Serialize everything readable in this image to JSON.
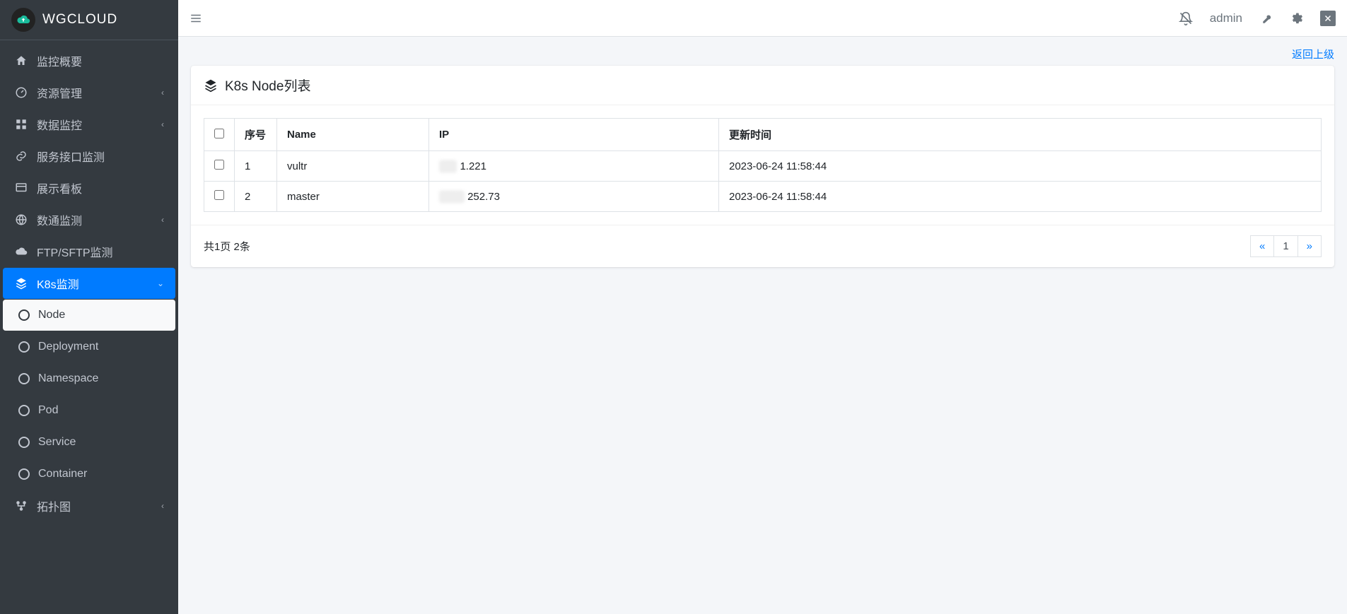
{
  "brand": {
    "text": "WGCLOUD"
  },
  "sidebar": {
    "items": [
      {
        "label": "监控概要",
        "icon": "home"
      },
      {
        "label": "资源管理",
        "icon": "dashboard",
        "chevron": true
      },
      {
        "label": "数据监控",
        "icon": "grid",
        "chevron": true
      },
      {
        "label": "服务接口监测",
        "icon": "link"
      },
      {
        "label": "展示看板",
        "icon": "board"
      },
      {
        "label": "数通监测",
        "icon": "globe",
        "chevron": true
      },
      {
        "label": "FTP/SFTP监测",
        "icon": "cloud"
      },
      {
        "label": "K8s监测",
        "icon": "layers",
        "chevron_down": true,
        "active": true,
        "children": [
          {
            "label": "Node",
            "active": true
          },
          {
            "label": "Deployment"
          },
          {
            "label": "Namespace"
          },
          {
            "label": "Pod"
          },
          {
            "label": "Service"
          },
          {
            "label": "Container"
          }
        ]
      },
      {
        "label": "拓扑图",
        "icon": "topology",
        "chevron": true
      }
    ]
  },
  "topbar": {
    "username": "admin"
  },
  "content": {
    "back_link": "返回上级",
    "card_title": "K8s Node列表",
    "columns": {
      "seq": "序号",
      "name": "Name",
      "ip": "IP",
      "updated": "更新时间"
    },
    "rows": [
      {
        "seq": "1",
        "name": "vultr",
        "ip_hidden": "██",
        "ip_tail": "1.221",
        "updated": "2023-06-24 11:58:44"
      },
      {
        "seq": "2",
        "name": "master",
        "ip_hidden": "███",
        "ip_tail": "252.73",
        "updated": "2023-06-24 11:58:44"
      }
    ],
    "footer_summary": "共1页 2条",
    "pager": {
      "prev": "«",
      "page": "1",
      "next": "»"
    }
  }
}
